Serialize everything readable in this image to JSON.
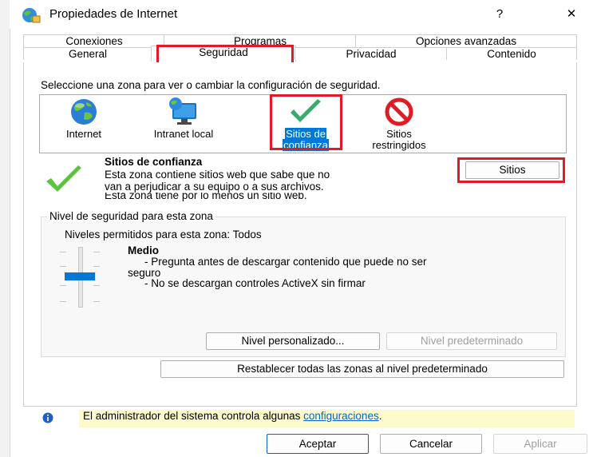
{
  "window": {
    "title": "Propiedades de Internet",
    "help_label": "?",
    "close_label": "✕"
  },
  "tabs_row1": [
    "Conexiones",
    "Programas",
    "Opciones avanzadas"
  ],
  "tabs_row2": [
    "General",
    "Seguridad",
    "Privacidad",
    "Contenido"
  ],
  "selected_tab": "Seguridad",
  "instruction": "Seleccione una zona para ver o cambiar la configuración de seguridad.",
  "zones": [
    {
      "icon": "globe-icon",
      "label_line1": "Internet",
      "label_line2": ""
    },
    {
      "icon": "intranet-icon",
      "label_line1": "Intranet local",
      "label_line2": ""
    },
    {
      "icon": "checkmark-icon",
      "label_line1": "Sitios de",
      "label_line2": "confianza"
    },
    {
      "icon": "prohibited-icon",
      "label_line1": "Sitios",
      "label_line2": "restringidos"
    }
  ],
  "selected_zone": "Sitios de confianza",
  "zone_info": {
    "title": "Sitios de confianza",
    "desc_line1": "Esta zona contiene sitios web que sabe que no",
    "desc_line2": "van a perjudicar a su equipo o a sus archivos.",
    "desc_line3": "Esta zona tiene por lo menos un sitio web."
  },
  "sites_button": "Sitios",
  "security_level": {
    "group_title": "Nivel de seguridad para esta zona",
    "allowed_levels": "Niveles permitidos para esta zona: Todos",
    "level_name": "Medio",
    "bullet1_line1": "- Pregunta antes de descargar contenido que puede no ser",
    "bullet1_line2": "seguro",
    "bullet2": "- No se descargan controles ActiveX sin firmar"
  },
  "custom_level_button": "Nivel personalizado...",
  "default_level_button": "Nivel predeterminado",
  "reset_all_button": "Restablecer todas las zonas al nivel predeterminado",
  "admin_notice": {
    "text": "El administrador del sistema controla algunas ",
    "link": "configuraciones",
    "suffix": "."
  },
  "footer": {
    "accept": "Aceptar",
    "cancel": "Cancelar",
    "apply": "Aplicar"
  },
  "colors": {
    "highlight_red": "#e01b24",
    "selection_blue": "#0078d7",
    "slider_thumb": "#0078d7",
    "info_bar": "#fdfbcc",
    "link": "#0066cc"
  }
}
